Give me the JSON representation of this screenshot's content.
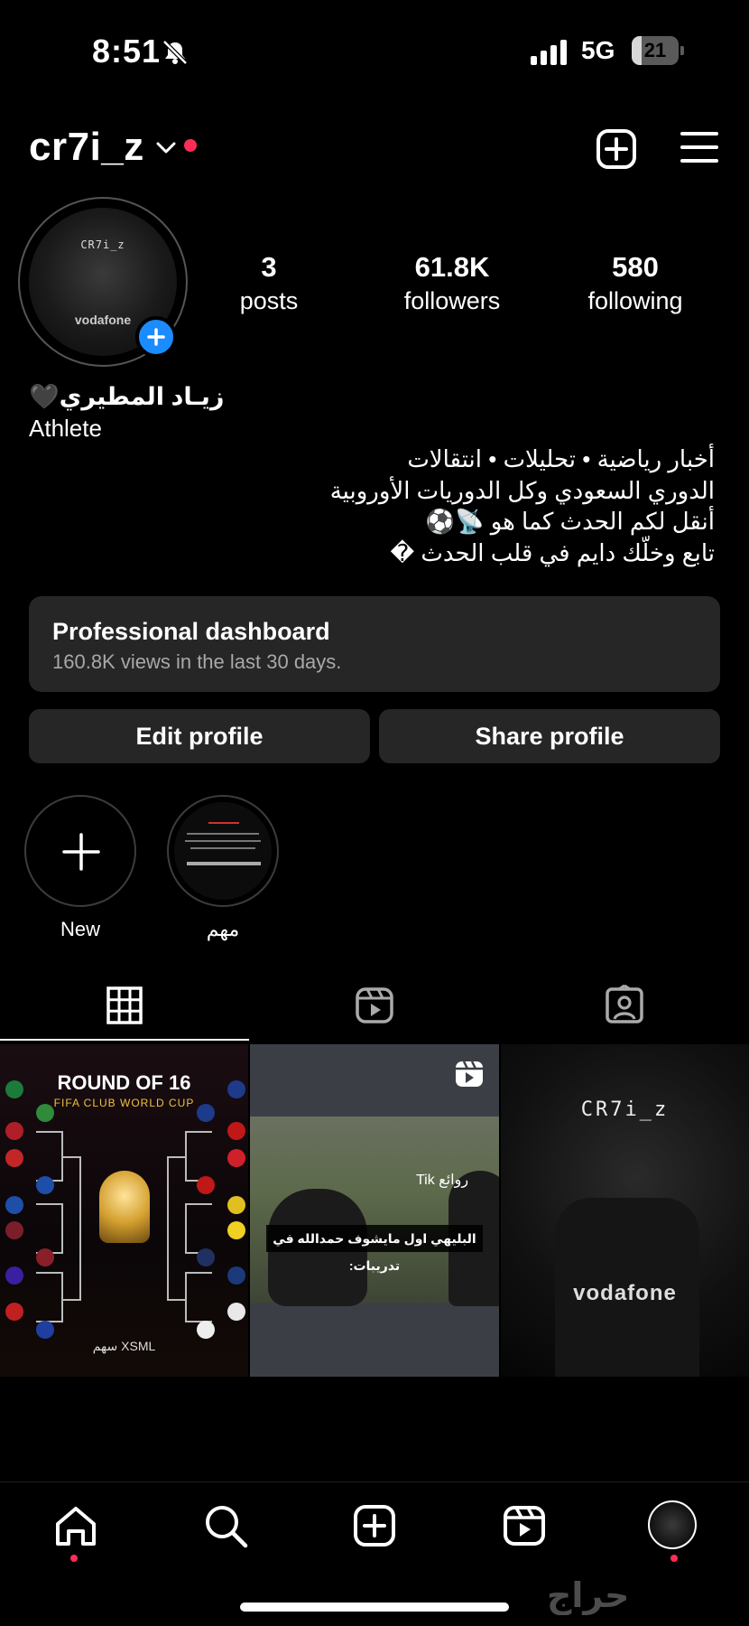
{
  "status_bar": {
    "time": "8:51",
    "network": "5G",
    "battery_level": 21,
    "battery_label": "21"
  },
  "header": {
    "username": "cr7i_z"
  },
  "profile": {
    "avatar_tag": "CR7i_z",
    "avatar_sponsor": "vodafone",
    "stats": [
      {
        "value": "3",
        "label": "posts"
      },
      {
        "value": "61.8K",
        "label": "followers"
      },
      {
        "value": "580",
        "label": "following"
      }
    ],
    "bio": {
      "name": "زيـاد المطيري🖤",
      "category": "Athlete",
      "lines": [
        "أخبار رياضية • تحليلات • انتقالات",
        "الدوري السعودي وكل الدوريات الأوروبية",
        "أنقل لكم الحدث كما هو 📡⚽",
        "تابع وخلّك دايم في قلب الحدث �"
      ]
    }
  },
  "dashboard": {
    "title": "Professional dashboard",
    "subtitle": "160.8K views in the last 30 days."
  },
  "buttons": {
    "edit": "Edit profile",
    "share": "Share profile"
  },
  "highlights": [
    {
      "label": "New",
      "icon": "plus-icon"
    },
    {
      "label": "مهم",
      "icon": "highlight-cover"
    }
  ],
  "tabs": [
    {
      "name": "posts-grid",
      "icon": "grid-icon",
      "active": true
    },
    {
      "name": "reels",
      "icon": "reels-icon",
      "active": false
    },
    {
      "name": "tagged",
      "icon": "tagged-icon",
      "active": false
    }
  ],
  "posts": [
    {
      "title": "ROUND OF 16",
      "subtitle": "FIFA CLUB WORLD CUP",
      "brand": "سهم XSML"
    },
    {
      "type": "reel",
      "caption": "البليهي اول مايشوف حمدالله في تدريبات:",
      "watermark": "روائع Tik"
    },
    {
      "tag": "CR7i_z",
      "sponsor": "vodafone"
    }
  ],
  "bottom_nav": [
    "home-icon",
    "search-icon",
    "create-icon",
    "reels-icon",
    "profile-avatar"
  ],
  "watermark": "حراج",
  "colors": {
    "background": "#000000",
    "accent_blue": "#1a8cff",
    "notification_red": "#ff2d55",
    "card": "#262626"
  }
}
